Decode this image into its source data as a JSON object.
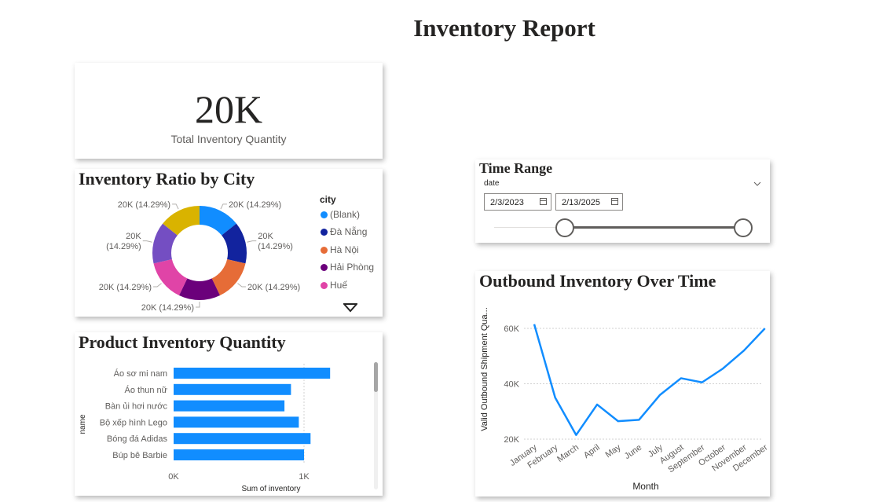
{
  "page": {
    "title": "Inventory Report"
  },
  "kpi": {
    "value": "20K",
    "label": "Total Inventory Quantity"
  },
  "city_chart": {
    "title": "Inventory Ratio by City",
    "legend_title": "city",
    "legend_items": [
      {
        "label": "(Blank)",
        "color": "#118DFF"
      },
      {
        "label": "Đà Nẵng",
        "color": "#12239E"
      },
      {
        "label": "Hà Nội",
        "color": "#E66C37"
      },
      {
        "label": "Hải Phòng",
        "color": "#6B007B"
      },
      {
        "label": "Huế",
        "color": "#E044A7"
      }
    ],
    "more_icon": "triangle-down-icon"
  },
  "time_range": {
    "title": "Time Range",
    "field_label": "date",
    "start": "2/3/2023",
    "end": "2/13/2025",
    "start_fraction": 0.0,
    "end_fraction": 1.0
  },
  "product_chart": {
    "title": "Product Inventory Quantity",
    "y_axis_label": "name",
    "x_axis_label": "Sum of inventory",
    "x_ticks": [
      "0K",
      "1K"
    ]
  },
  "outbound_chart": {
    "title": "Outbound Inventory Over Time",
    "y_axis_label": "Valid Outbound Shipment Qua...",
    "x_axis_label": "Month",
    "y_ticks": [
      "60K",
      "40K",
      "20K"
    ]
  },
  "chart_data": [
    {
      "type": "pie",
      "title": "Inventory Ratio by City",
      "categories": [
        "(Blank)",
        "Đà Nẵng",
        "Hà Nội",
        "Hải Phòng",
        "Huế",
        "",
        ""
      ],
      "colors": [
        "#118DFF",
        "#12239E",
        "#E66C37",
        "#6B007B",
        "#E044A7",
        "#744EC2",
        "#D9B300"
      ],
      "values": [
        14.29,
        14.29,
        14.29,
        14.29,
        14.29,
        14.29,
        14.29
      ],
      "data_labels": [
        [
          "20K (14.29%)"
        ],
        [
          "20K",
          "(14.29%)"
        ],
        [
          "20K (14.29%)"
        ],
        [
          "20K (14.29%)"
        ],
        [
          "20K (14.29%)"
        ],
        [
          "20K",
          "(14.29%)"
        ],
        [
          "20K (14.29%)"
        ]
      ]
    },
    {
      "type": "bar",
      "title": "Product Inventory Quantity",
      "categories": [
        "Áo sơ mi nam",
        "Áo thun nữ",
        "Bàn ủi hơi nước",
        "Bộ xếp hình Lego",
        "Bóng đá Adidas",
        "Búp bê Barbie"
      ],
      "values": [
        1200,
        900,
        850,
        960,
        1050,
        1000
      ],
      "xlim": [
        0,
        1000
      ],
      "xlabel": "Sum of inventory",
      "ylabel": "name",
      "color": "#118DFF"
    },
    {
      "type": "line",
      "title": "Outbound Inventory Over Time",
      "x": [
        "January",
        "February",
        "March",
        "April",
        "May",
        "June",
        "July",
        "August",
        "September",
        "October",
        "November",
        "December"
      ],
      "values": [
        61500,
        35000,
        21500,
        32500,
        26500,
        27000,
        36000,
        42000,
        40500,
        45500,
        52000,
        60000
      ],
      "ylim": [
        20000,
        60000
      ],
      "xlabel": "Month",
      "ylabel": "Valid Outbound Shipment Qua...",
      "color": "#118DFF"
    }
  ]
}
